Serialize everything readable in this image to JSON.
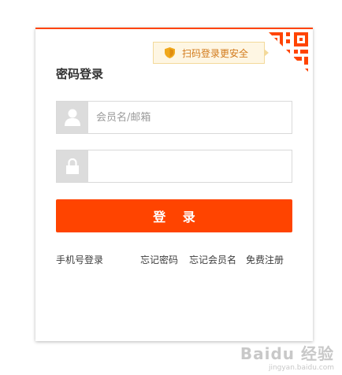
{
  "login_card": {
    "title": "密码登录",
    "safe_tip": "扫码登录更安全",
    "username_placeholder": "会员名/邮箱",
    "password_value": "",
    "submit_label": "登 录",
    "links": {
      "phone_login": "手机号登录",
      "forgot_password": "忘记密码",
      "forgot_username": "忘记会员名",
      "register": "免费注册"
    }
  },
  "watermark": {
    "text": "Baidu 经验",
    "sub": "jingyan.baidu.com"
  },
  "colors": {
    "accent": "#ff4400",
    "tip_bg": "#fef6e3",
    "tip_text": "#d27a1b",
    "icon_box": "#dcdcdc"
  },
  "icons": {
    "user": "user-icon",
    "lock": "lock-icon",
    "shield": "shield-icon",
    "qr": "qr-code-icon"
  }
}
